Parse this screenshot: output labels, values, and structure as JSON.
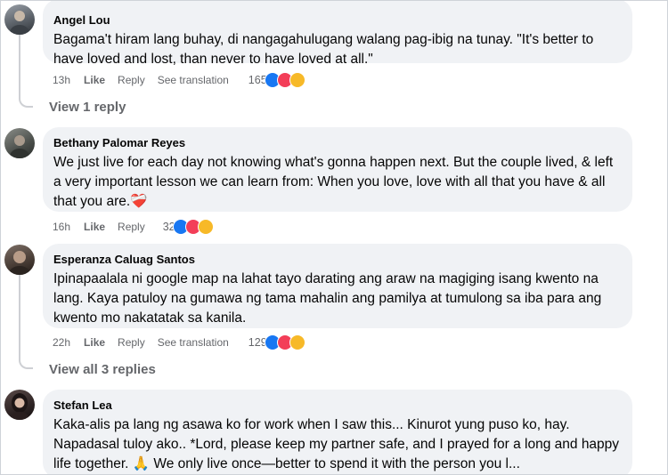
{
  "comments": [
    {
      "author": "Angel Lou",
      "text": "Bagama't hiram lang buhay, di nangagahulugang walang pag-ibig na tunay. \"It's better to have loved and lost, than never to have loved at all.\"",
      "time": "13h",
      "like": "Like",
      "reply": "Reply",
      "see_translation": "See translation",
      "reaction_count": "165",
      "view_replies": "View 1 reply"
    },
    {
      "author": "Bethany Palomar Reyes",
      "text": "We just live for each day not knowing what's gonna happen next. But the couple lived, & left a very important lesson we can learn from: When you love, love with all that you have & all that you are.",
      "text_emoji": "❤️‍🩹",
      "time": "16h",
      "like": "Like",
      "reply": "Reply",
      "reaction_count": "32"
    },
    {
      "author": "Esperanza Caluag Santos",
      "text": "Ipinapaalala ni google map na lahat tayo darating ang araw na magiging isang kwento na lang. Kaya patuloy na gumawa ng tama mahalin ang pamilya at tumulong sa iba para ang kwento mo nakatatak sa kanila.",
      "time": "22h",
      "like": "Like",
      "reply": "Reply",
      "see_translation": "See translation",
      "reaction_count": "129",
      "view_replies": "View all 3 replies"
    },
    {
      "author": "Stefan Lea",
      "text": "Kaka-alis pa lang ng asawa ko for work when I saw this... Kinurot yung puso ko, hay. Napadasal tuloy ako.. *Lord, please keep my partner safe, and I prayed for a long and happy life together. 🙏 We only live once—better to spend it with the person you l..."
    }
  ],
  "colors": {
    "bubble": "#f0f2f5",
    "meta": "#65676b",
    "like": "#1877f2",
    "love": "#f33e58",
    "care": "#f7b928"
  },
  "icons": {
    "like": "like-reaction-icon",
    "love": "love-reaction-icon",
    "care": "care-reaction-icon"
  }
}
